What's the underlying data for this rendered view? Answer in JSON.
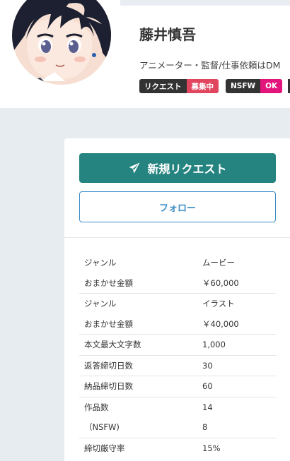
{
  "profile": {
    "name": "藤井慎吾",
    "bio": "アニメーター・監督/仕事依頼はDM"
  },
  "badges": [
    {
      "label": "リクエスト",
      "value": "募集中"
    },
    {
      "label": "NSFW",
      "value": "OK"
    }
  ],
  "actions": {
    "new_request": "新規リクエスト",
    "follow": "フォロー"
  },
  "stats": [
    {
      "key": "ジャンル",
      "value": "ムービー"
    },
    {
      "key": "おまかせ金額",
      "value": "￥60,000"
    },
    {
      "key": "ジャンル",
      "value": "イラスト"
    },
    {
      "key": "おまかせ金額",
      "value": "￥40,000"
    },
    {
      "key": "本文最大文字数",
      "value": "1,000"
    },
    {
      "key": "返答締切日数",
      "value": "30"
    },
    {
      "key": "納品締切日数",
      "value": "60"
    },
    {
      "key": "作品数",
      "value": "14"
    },
    {
      "key": "（NSFW)",
      "value": "8"
    },
    {
      "key": "締切厳守率",
      "value": "15%"
    }
  ],
  "colors": {
    "primary": "#258480",
    "link": "#3c8dc6",
    "badge_dark": "#333333",
    "badge_red": "#e2465f",
    "badge_pink": "#e3157c"
  }
}
